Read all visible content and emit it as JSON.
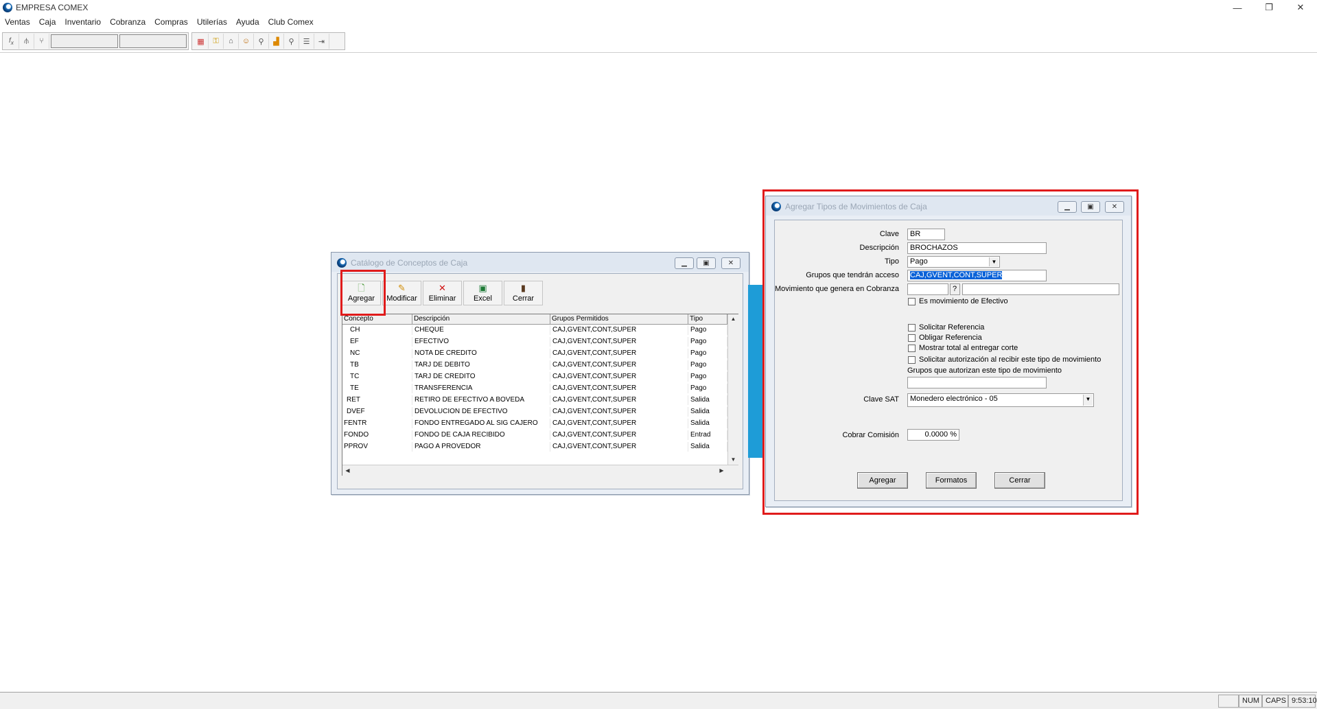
{
  "app": {
    "title": "EMPRESA COMEX",
    "minimize": "—",
    "maximize": "❐",
    "close": "✕"
  },
  "menu": [
    "Ventas",
    "Caja",
    "Inventario",
    "Cobranza",
    "Compras",
    "Utilerías",
    "Ayuda",
    "Club Comex"
  ],
  "toolbar_icons": [
    "fx-icon",
    "branch-icon",
    "fork-icon",
    "abacus-icon",
    "key-icon",
    "bank-icon",
    "user-icon",
    "search-icon",
    "chart-icon",
    "magnify-icon",
    "list-icon",
    "exit-icon"
  ],
  "catalog": {
    "title": "Catálogo de Conceptos de Caja",
    "tools": [
      {
        "label": "Agregar",
        "icon": "add-doc-icon"
      },
      {
        "label": "Modificar",
        "icon": "edit-icon"
      },
      {
        "label": "Eliminar",
        "icon": "delete-icon"
      },
      {
        "label": "Excel",
        "icon": "excel-icon"
      },
      {
        "label": "Cerrar",
        "icon": "door-icon"
      }
    ],
    "columns": [
      "Concepto",
      "Descripción",
      "Grupos Permitidos",
      "Tipo"
    ],
    "rows": [
      [
        "CH",
        "CHEQUE",
        "CAJ,GVENT,CONT,SUPER",
        "Pago"
      ],
      [
        "EF",
        "EFECTIVO",
        "CAJ,GVENT,CONT,SUPER",
        "Pago"
      ],
      [
        "NC",
        "NOTA DE CREDITO",
        "CAJ,GVENT,CONT,SUPER",
        "Pago"
      ],
      [
        "TB",
        "TARJ DE DEBITO",
        "CAJ,GVENT,CONT,SUPER",
        "Pago"
      ],
      [
        "TC",
        "TARJ DE CREDITO",
        "CAJ,GVENT,CONT,SUPER",
        "Pago"
      ],
      [
        "TE",
        "TRANSFERENCIA",
        "CAJ,GVENT,CONT,SUPER",
        "Pago"
      ],
      [
        "RET",
        "RETIRO DE EFECTIVO A BOVEDA",
        "CAJ,GVENT,CONT,SUPER",
        "Salida"
      ],
      [
        "DVEF",
        "DEVOLUCION DE EFECTIVO",
        "CAJ,GVENT,CONT,SUPER",
        "Salida"
      ],
      [
        "FENTR",
        "FONDO ENTREGADO AL SIG CAJERO",
        "CAJ,GVENT,CONT,SUPER",
        "Salida"
      ],
      [
        "FONDO",
        "FONDO DE CAJA RECIBIDO",
        "CAJ,GVENT,CONT,SUPER",
        "Entrad"
      ],
      [
        "PPROV",
        "PAGO A PROVEDOR",
        "CAJ,GVENT,CONT,SUPER",
        "Salida"
      ]
    ]
  },
  "form": {
    "title": "Agregar Tipos de Movimientos de Caja",
    "clave_label": "Clave",
    "clave": "BR",
    "descripcion_label": "Descripción",
    "descripcion": "BROCHAZOS",
    "tipo_label": "Tipo",
    "tipo": "Pago",
    "grupos_label": "Grupos que tendrán acceso",
    "grupos": "CAJ,GVENT,CONT,SUPER",
    "movimiento_label": "Movimiento que genera en Cobranza",
    "movimiento_btn": "?",
    "es_efectivo": "Es movimiento de Efectivo",
    "solicitar_ref": "Solicitar Referencia",
    "obligar_ref": "Obligar Referencia",
    "mostrar_total": "Mostrar total al entregar corte",
    "solicitar_aut": "Solicitar autorización al recibir este tipo de movimiento",
    "grupos_autorizan": "Grupos que autorizan este tipo de movimiento",
    "clave_sat_label": "Clave SAT",
    "clave_sat": "Monedero electrónico - 05",
    "comision_label": "Cobrar Comisión",
    "comision": "0.0000 %",
    "btn_agregar": "Agregar",
    "btn_formatos": "Formatos",
    "btn_cerrar": "Cerrar"
  },
  "status": {
    "num": "NUM",
    "caps": "CAPS",
    "time": "9:53:10"
  },
  "colors": {
    "highlight": "#e01b1b",
    "selection": "#0a62d8",
    "backdrop_blue": "#1e9cd7"
  }
}
